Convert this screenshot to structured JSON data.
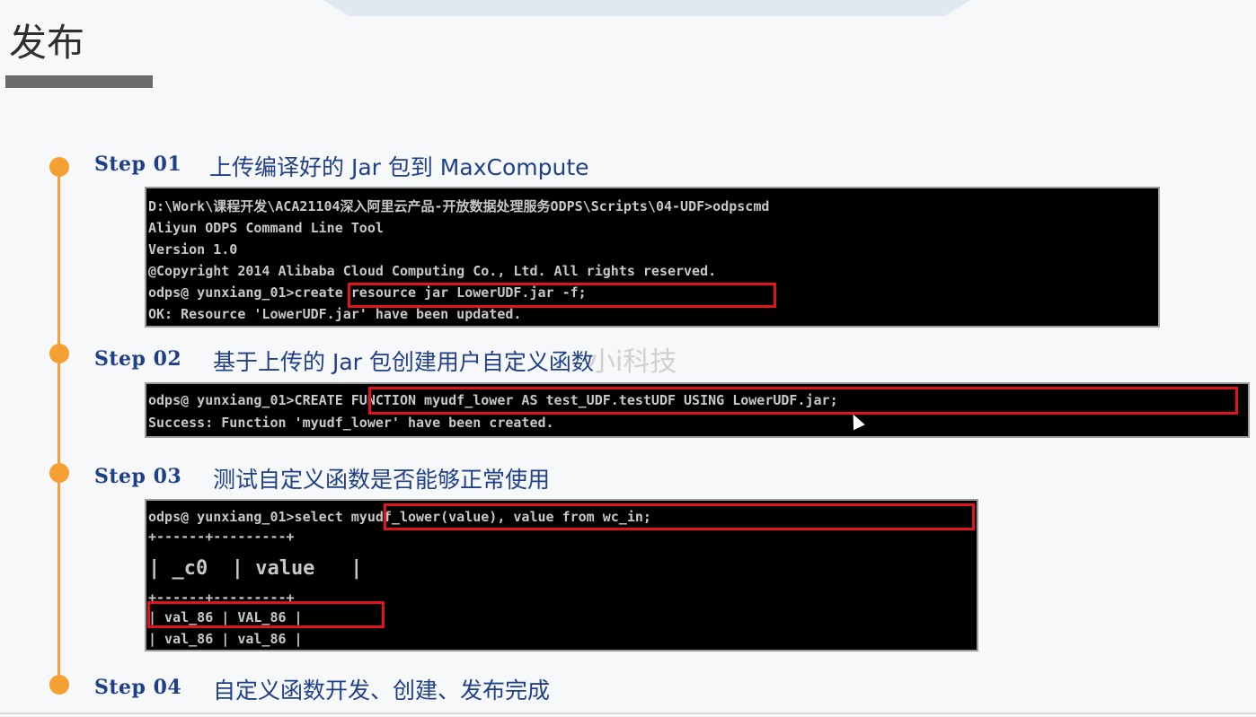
{
  "title": "发布",
  "watermark": "小i科技",
  "steps": [
    {
      "label": "Step 01",
      "text": "上传编译好的 Jar 包到 MaxCompute"
    },
    {
      "label": "Step 02",
      "text": "基于上传的 Jar 包创建用户自定义函数"
    },
    {
      "label": "Step 03",
      "text": "测试自定义函数是否能够正常使用"
    },
    {
      "label": "Step 04",
      "text": "自定义函数开发、创建、发布完成"
    }
  ],
  "console1": {
    "lines": [
      "D:\\Work\\课程开发\\ACA21104深入阿里云产品-开放数据处理服务ODPS\\Scripts\\04-UDF>odpscmd",
      "Aliyun ODPS Command Line Tool",
      "Version 1.0",
      "@Copyright 2014 Alibaba Cloud Computing Co., Ltd. All rights reserved.",
      "odps@ yunxiang_01>create resource jar LowerUDF.jar -f;",
      "OK: Resource 'LowerUDF.jar' have been updated."
    ]
  },
  "console2": {
    "lines": [
      "odps@ yunxiang_01>CREATE FUNCTION myudf_lower AS test_UDF.testUDF USING LowerUDF.jar;",
      "Success: Function 'myudf_lower' have been created."
    ]
  },
  "console3": {
    "lines": [
      "odps@ yunxiang_01>select myudf_lower(value), value from wc_in;",
      "+------+---------+",
      "| _c0  | value   |",
      "+------+---------+",
      "| val_86 | VAL_86 |",
      "| val_86 | val_86 |"
    ]
  }
}
